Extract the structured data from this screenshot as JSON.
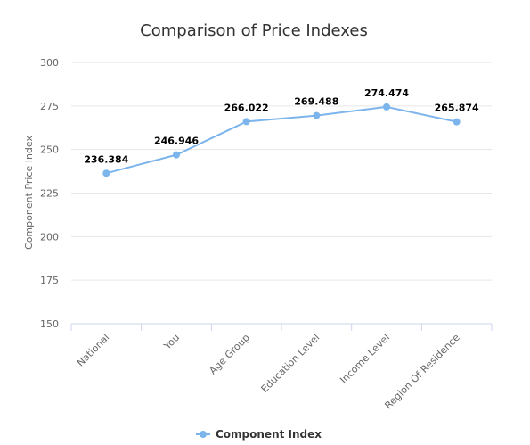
{
  "chart_data": {
    "type": "line",
    "title": "Comparison of Price Indexes",
    "xlabel": "",
    "ylabel": "Component Price Index",
    "categories": [
      "National",
      "You",
      "Age Group",
      "Education Level",
      "Income Level",
      "Region Of Residence"
    ],
    "series": [
      {
        "name": "Component Index",
        "values": [
          236.384,
          246.946,
          266.022,
          269.488,
          274.474,
          265.874
        ],
        "labels": [
          "236.384",
          "246.946",
          "266.022",
          "269.488",
          "274.474",
          "265.874"
        ],
        "color": "#7cb5ec"
      }
    ],
    "ylim": [
      150,
      300
    ],
    "yticks": [
      "150",
      "175",
      "200",
      "225",
      "250",
      "275",
      "300"
    ],
    "grid": true,
    "legend_position": "bottom-center"
  }
}
